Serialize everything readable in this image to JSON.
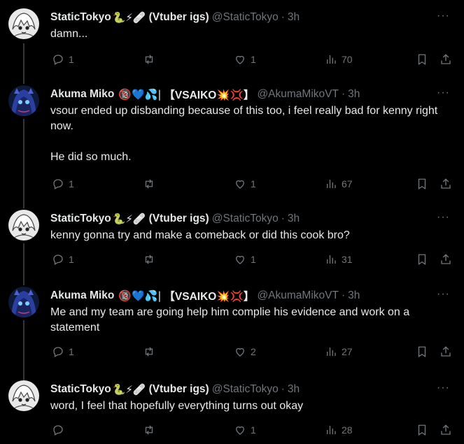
{
  "posts": [
    {
      "name": "StaticTokyo",
      "emojis": "🐍⚡🩹",
      "name_suffix": "(Vtuber igs)",
      "handle": "@StaticTokyo",
      "time": "3h",
      "text": "damn...",
      "replies": "1",
      "reposts": "",
      "likes": "1",
      "views": "70"
    },
    {
      "name": "Akuma Miko",
      "emojis": "🔞💙💦|",
      "name_suffix": "【VSAIKO💥💢】",
      "handle": "@AkumaMikoVT",
      "time": "3h",
      "text": "vsour ended up disbanding because of this too, i feel really bad for kenny right now.\n\nHe did so much.",
      "replies": "1",
      "reposts": "",
      "likes": "1",
      "views": "67"
    },
    {
      "name": "StaticTokyo",
      "emojis": "🐍⚡🩹",
      "name_suffix": "(Vtuber igs)",
      "handle": "@StaticTokyo",
      "time": "3h",
      "text": "kenny gonna try and make a comeback or did this cook bro?",
      "replies": "1",
      "reposts": "",
      "likes": "1",
      "views": "31"
    },
    {
      "name": "Akuma Miko",
      "emojis": "🔞💙💦|",
      "name_suffix": "【VSAIKO💥💢】",
      "handle": "@AkumaMikoVT",
      "time": "3h",
      "text": "Me and my team are going help him complie his evidence and work on a statement",
      "replies": "1",
      "reposts": "",
      "likes": "2",
      "views": "27"
    },
    {
      "name": "StaticTokyo",
      "emojis": "🐍⚡🩹",
      "name_suffix": "(Vtuber igs)",
      "handle": "@StaticTokyo",
      "time": "3h",
      "text": "word, I feel that hopefully everything turns out okay",
      "replies": "",
      "reposts": "",
      "likes": "1",
      "views": "28"
    }
  ],
  "ui": {
    "dot": "·",
    "more": "···"
  }
}
